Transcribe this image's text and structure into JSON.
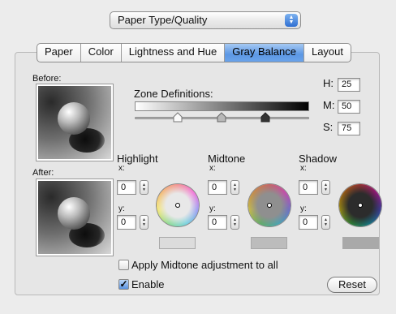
{
  "popup": {
    "value": "Paper Type/Quality"
  },
  "tabs": [
    {
      "label": "Paper",
      "active": false
    },
    {
      "label": "Color",
      "active": false
    },
    {
      "label": "Lightness and Hue",
      "active": false
    },
    {
      "label": "Gray Balance",
      "active": true
    },
    {
      "label": "Layout",
      "active": false
    }
  ],
  "preview": {
    "before_label": "Before:",
    "after_label": "After:"
  },
  "zone": {
    "label": "Zone Definitions:"
  },
  "hsl": {
    "h_label": "H:",
    "h_value": "25",
    "m_label": "M:",
    "m_value": "50",
    "s_label": "S:",
    "s_value": "75"
  },
  "zones": [
    {
      "title": "Highlight",
      "x_label": "x:",
      "x_value": "0",
      "y_label": "y:",
      "y_value": "0",
      "center_color": "#e8e8e8",
      "swatch_color": "#dcdcdc"
    },
    {
      "title": "Midtone",
      "x_label": "x:",
      "x_value": "0",
      "y_label": "y:",
      "y_value": "0",
      "center_color": "#8f8f8f",
      "swatch_color": "#bcbcbc"
    },
    {
      "title": "Shadow",
      "x_label": "x:",
      "x_value": "0",
      "y_label": "y:",
      "y_value": "0",
      "center_color": "#2c2c2c",
      "swatch_color": "#a9a9a9"
    }
  ],
  "options": {
    "apply_midtone_label": "Apply Midtone adjustment to all",
    "apply_midtone_checked": false,
    "enable_label": "Enable",
    "enable_checked": true
  },
  "buttons": {
    "reset_label": "Reset"
  },
  "icons": {
    "popup_arrows": "updown-arrows-icon",
    "stepper": "stepper-arrows-icon",
    "slider_knob": "slider-knob-icon"
  }
}
